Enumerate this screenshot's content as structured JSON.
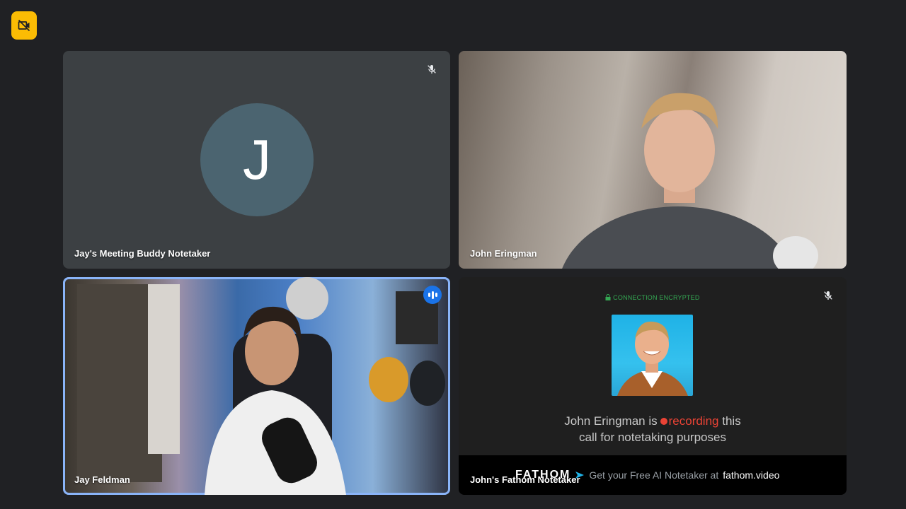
{
  "participants": [
    {
      "name": "Jay's Meeting Buddy Notetaker",
      "initial": "J"
    },
    {
      "name": "John Eringman"
    },
    {
      "name": "Jay Feldman"
    },
    {
      "name": "John's Fathom Notetaker"
    }
  ],
  "fathom": {
    "connection_label": "CONNECTION ENCRYPTED",
    "recording_line1_a": "John Eringman is",
    "recording_word": "recording",
    "recording_line1_b": "this",
    "recording_line2": "call for notetaking purposes",
    "brand": "FATHOM",
    "promo": "Get your Free AI Notetaker at",
    "link": "fathom.video"
  },
  "colors": {
    "accent_yellow": "#fbbc04",
    "speaking_blue": "#1a73e8",
    "recording_red": "#ea4335",
    "encrypted_green": "#34a853"
  },
  "icons": [
    "camera-off-icon",
    "mic-off-icon",
    "speaking-indicator-icon",
    "lock-icon",
    "fathom-arrow-icon"
  ]
}
